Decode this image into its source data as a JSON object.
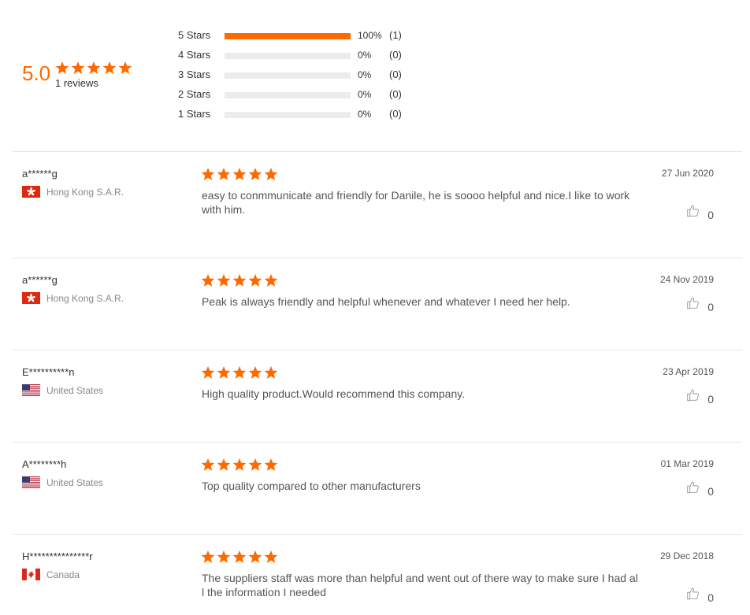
{
  "summary": {
    "score": "5.0",
    "reviews_label": "1 reviews",
    "breakdown": [
      {
        "label": "5  Stars",
        "percent_text": "100%",
        "count_text": "(1)",
        "fill": 1.0
      },
      {
        "label": "4  Stars",
        "percent_text": "0%",
        "count_text": "(0)",
        "fill": 0
      },
      {
        "label": "3  Stars",
        "percent_text": "0%",
        "count_text": "(0)",
        "fill": 0
      },
      {
        "label": "2  Stars",
        "percent_text": "0%",
        "count_text": "(0)",
        "fill": 0
      },
      {
        "label": "1  Stars",
        "percent_text": "0%",
        "count_text": "(0)",
        "fill": 0
      }
    ]
  },
  "colors": {
    "accent": "#ff6a00",
    "track": "#ececec"
  },
  "reviews": [
    {
      "reviewer": "a******g",
      "country": "Hong Kong S.A.R.",
      "flag": "hong-kong",
      "stars": 5,
      "date": "27 Jun 2020",
      "text": "easy to conmmunicate and friendly for Danile, he is soooo helpful and nice.I like to work with him.",
      "likes": "0"
    },
    {
      "reviewer": "a******g",
      "country": "Hong Kong S.A.R.",
      "flag": "hong-kong",
      "stars": 5,
      "date": "24 Nov 2019",
      "text": "Peak is always friendly and helpful whenever and whatever I need her help.",
      "likes": "0"
    },
    {
      "reviewer": "E**********n",
      "country": "United States",
      "flag": "united-states",
      "stars": 5,
      "date": "23 Apr 2019",
      "text": "High quality product.Would recommend this company.",
      "likes": "0"
    },
    {
      "reviewer": "A********h",
      "country": "United States",
      "flag": "united-states",
      "stars": 5,
      "date": "01 Mar 2019",
      "text": "Top quality compared to other manufacturers",
      "likes": "0"
    },
    {
      "reviewer": "H***************r",
      "country": "Canada",
      "flag": "canada",
      "stars": 5,
      "date": "29 Dec 2018",
      "text": "The suppliers staff was more than helpful and went out of there way to make sure I had all the information I needed",
      "likes": "0"
    }
  ]
}
